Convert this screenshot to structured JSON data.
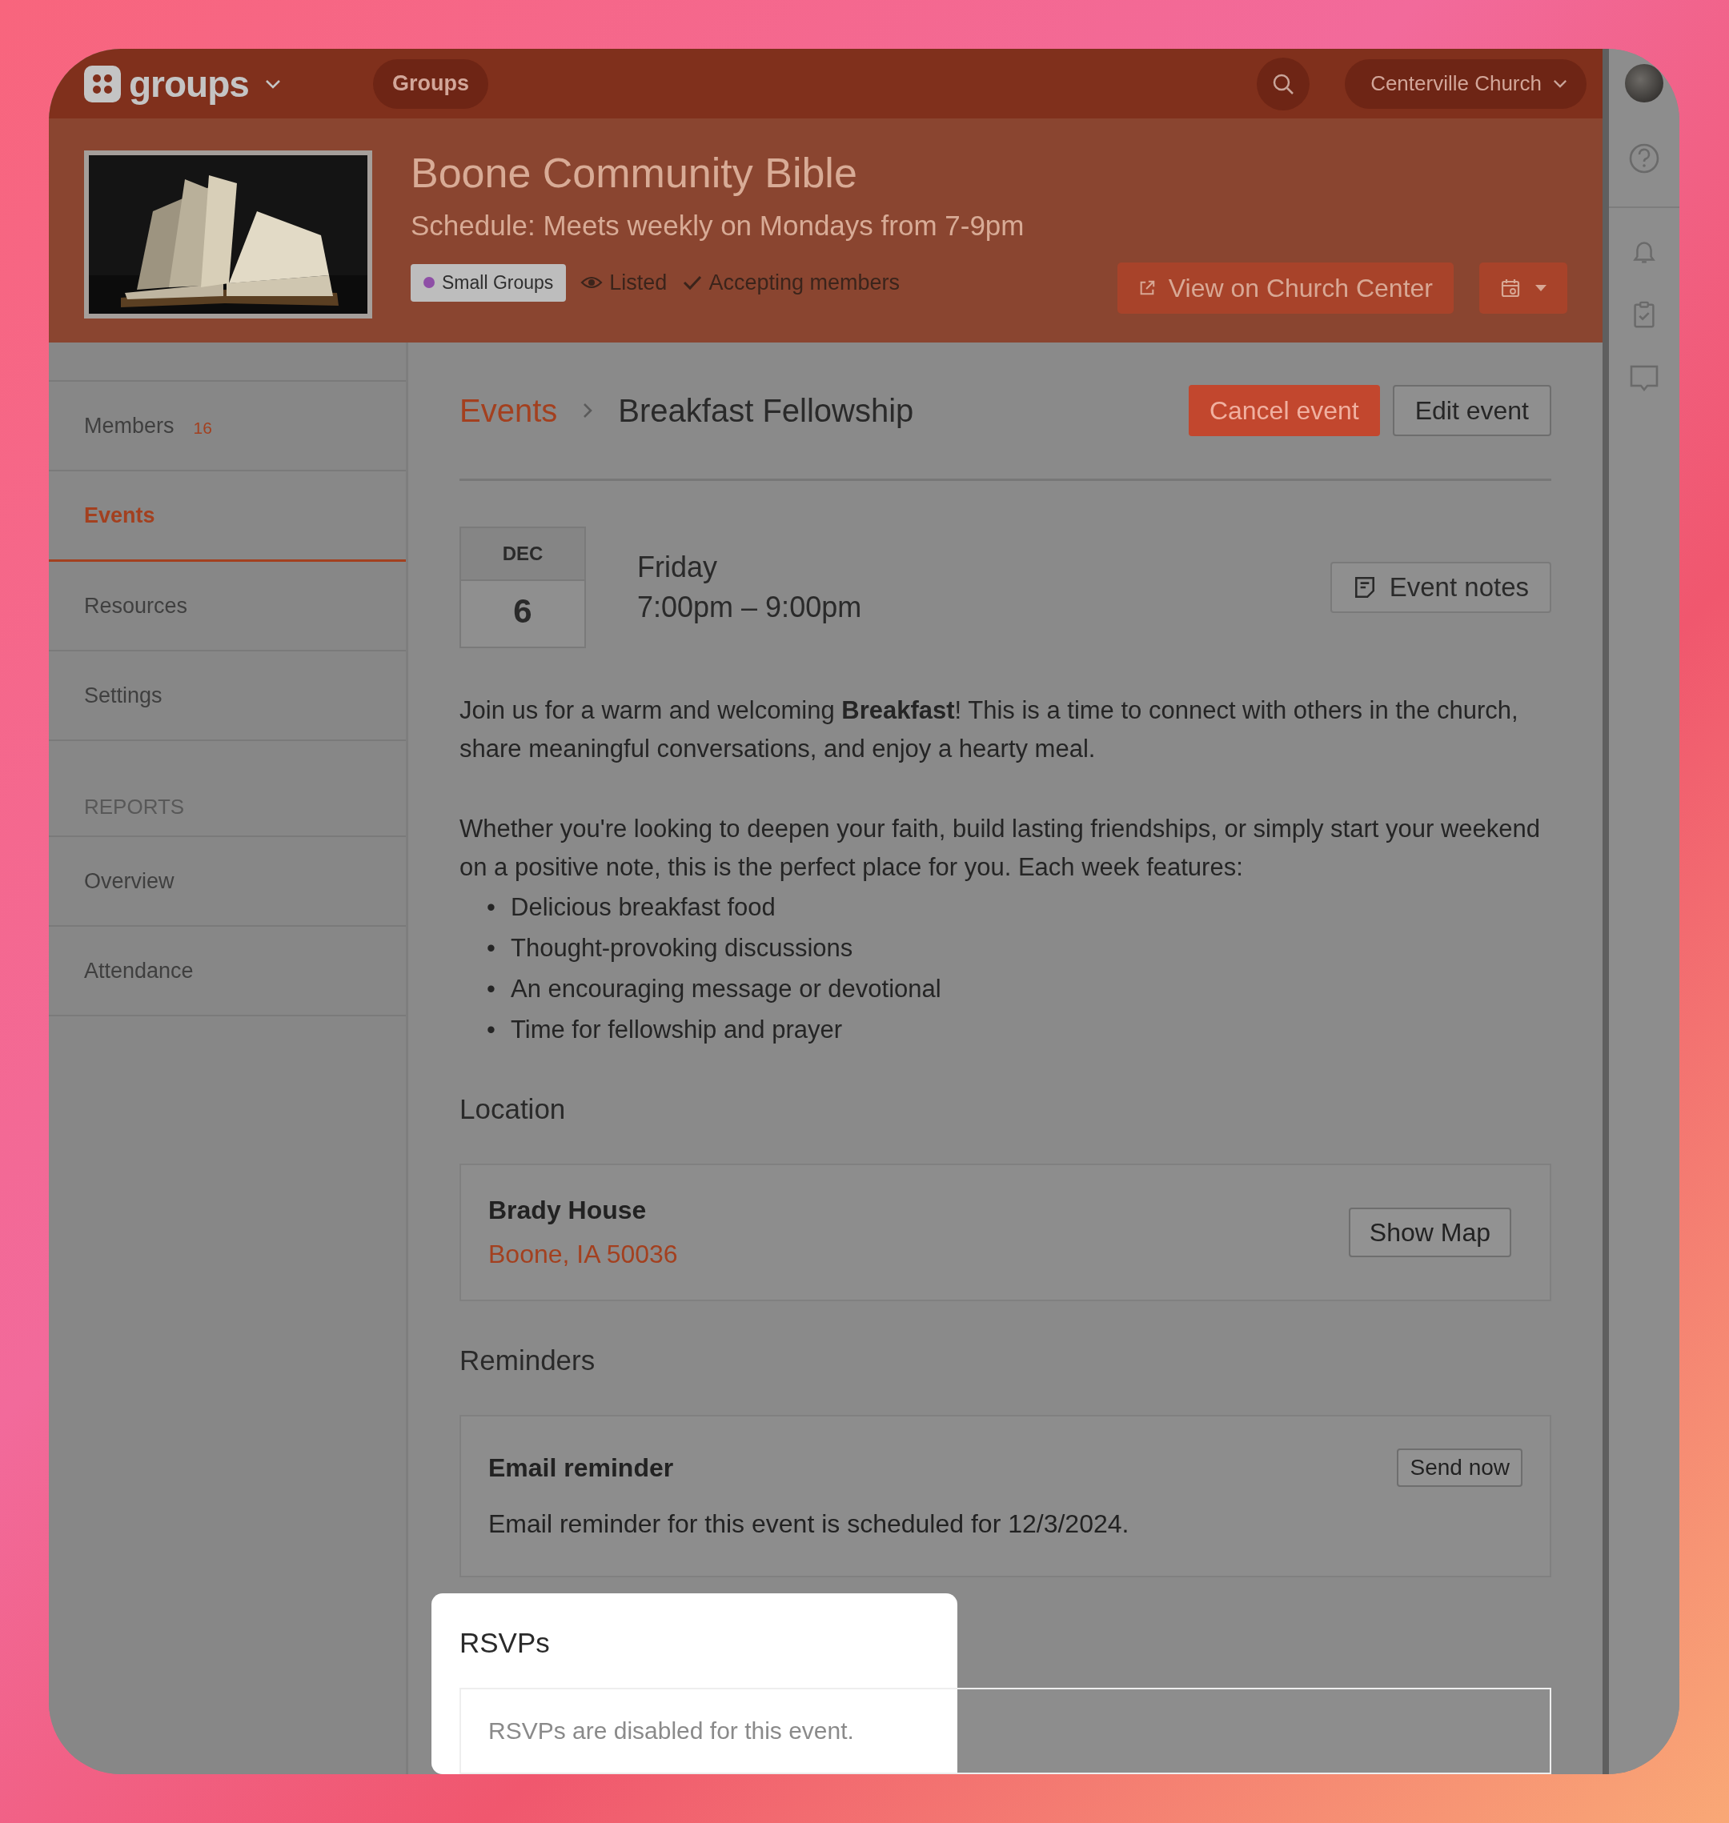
{
  "app": {
    "name": "groups",
    "nav_button": "Groups",
    "account": "Centerville Church"
  },
  "group": {
    "title": "Boone Community Bible",
    "schedule": "Schedule: Meets weekly on Mondays from 7-9pm",
    "tag": {
      "label": "Small Groups",
      "color": "#8e4fa6"
    },
    "visibility": "Listed",
    "status": "Accepting members",
    "view_button": "View on Church Center"
  },
  "sidebar": {
    "items": [
      {
        "label": "Members",
        "count": "16",
        "selected": false
      },
      {
        "label": "Events",
        "selected": true
      },
      {
        "label": "Resources",
        "selected": false
      },
      {
        "label": "Settings",
        "selected": false
      }
    ],
    "reports_heading": "REPORTS",
    "report_items": [
      {
        "label": "Overview",
        "selected": false
      },
      {
        "label": "Attendance",
        "selected": false
      }
    ]
  },
  "breadcrumb": [
    "Events",
    "Breakfast Fellowship"
  ],
  "actions": [
    {
      "label": "Cancel event",
      "kind": "danger"
    },
    {
      "label": "Edit event",
      "kind": "default"
    }
  ],
  "event": {
    "month": "DEC",
    "day": "6",
    "weekday": "Friday",
    "time": "7:00pm – 9:00pm",
    "notes_button": "Event notes",
    "description": [
      "Join us for a warm and welcoming **Breakfast**! This is a time to connect with others in the church, share meaningful conversations, and enjoy a hearty meal.",
      "Whether you're looking to deepen your faith, build lasting friendships, or simply start your weekend on a positive note, this is the perfect place for you. Each week features:"
    ],
    "features": [
      {
        "marker": "•",
        "text": "Delicious breakfast food"
      },
      {
        "marker": "•",
        "text": "Thought-provoking discussions"
      },
      {
        "marker": "•",
        "text": "An encouraging message or devotional"
      },
      {
        "marker": "•",
        "text": "Time for fellowship and prayer"
      }
    ]
  },
  "location": {
    "heading": "Location",
    "name": "Brady House",
    "address": "Boone, IA 50036",
    "button": "Show Map"
  },
  "reminders": {
    "heading": "Reminders",
    "title": "Email reminder",
    "button": "Send now",
    "text": "Email reminder for this event is scheduled for 12/3/2024."
  },
  "rsvps": {
    "heading": "RSVPs",
    "message": "RSVPs are disabled for this event.",
    "highlighted": true
  }
}
